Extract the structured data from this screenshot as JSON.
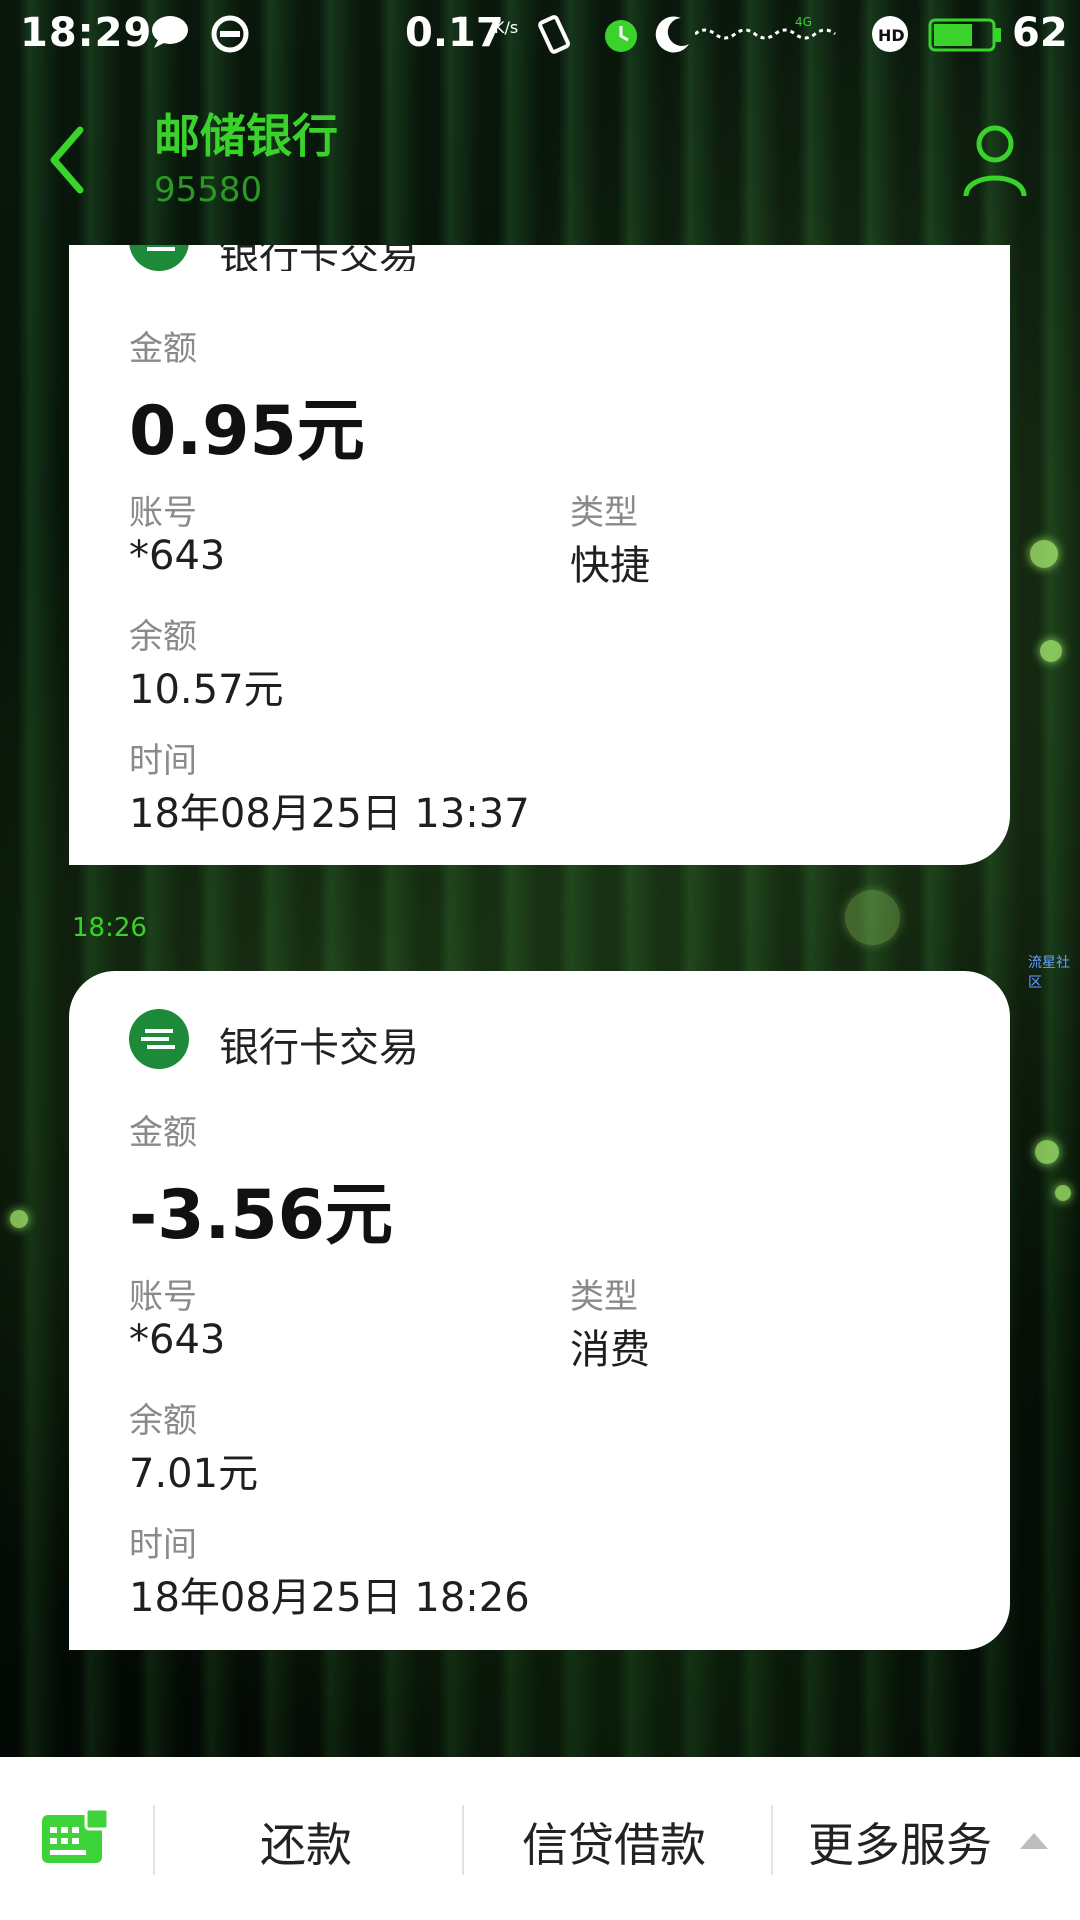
{
  "status": {
    "time": "18:29",
    "net_speed": "0.17",
    "net_unit": "K/s",
    "network": "4G",
    "battery": "62"
  },
  "header": {
    "title": "邮储银行",
    "number": "95580"
  },
  "messages": [
    {
      "title": "银行卡交易",
      "amount_label": "金额",
      "amount": "0.95元",
      "account_label": "账号",
      "account": "*643",
      "type_label": "类型",
      "type": "快捷",
      "balance_label": "余额",
      "balance": "10.57元",
      "time_label": "时间",
      "time": "18年08月25日 13:37"
    },
    {
      "sent_time": "18:26",
      "title": "银行卡交易",
      "amount_label": "金额",
      "amount": "-3.56元",
      "account_label": "账号",
      "account": "*643",
      "type_label": "类型",
      "type": "消费",
      "balance_label": "余额",
      "balance": "7.01元",
      "time_label": "时间",
      "time": "18年08月25日 18:26"
    }
  ],
  "watermark": "流星社区",
  "bottom_menu": {
    "items": [
      "还款",
      "信贷借款",
      "更多服务"
    ]
  },
  "colors": {
    "accent": "#39d32c",
    "card_bg": "#ffffff",
    "bank_logo": "#1d8a3a"
  },
  "icons": [
    "chat-bubble-icon",
    "app-icon",
    "vibrate-icon",
    "alarm-icon",
    "moon-icon",
    "signal-icon",
    "hd-icon",
    "battery-icon",
    "back-arrow-icon",
    "profile-icon",
    "keyboard-icon",
    "caret-up-icon",
    "bank-logo-icon"
  ]
}
